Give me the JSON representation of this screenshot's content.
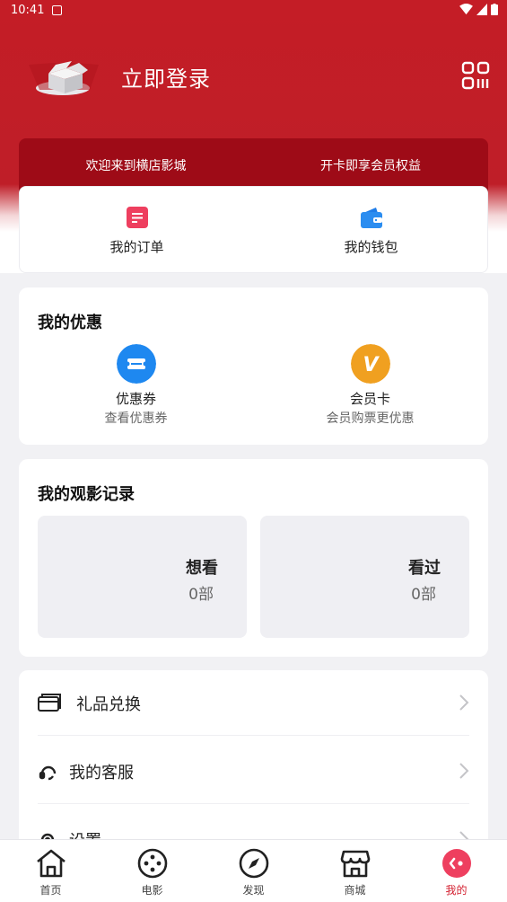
{
  "status_bar": {
    "time": "10:41"
  },
  "header": {
    "login_label": "立即登录"
  },
  "banner": {
    "left_text": "欢迎来到横店影城",
    "right_text": "开卡即享会员权益"
  },
  "quick_actions": [
    {
      "label": "我的订单",
      "icon": "order-icon"
    },
    {
      "label": "我的钱包",
      "icon": "wallet-icon"
    }
  ],
  "promotions": {
    "title": "我的优惠",
    "items": [
      {
        "title": "优惠券",
        "subtitle": "查看优惠券",
        "icon": "coupon-icon",
        "color": "#1e88f0"
      },
      {
        "title": "会员卡",
        "subtitle": "会员购票更优惠",
        "icon": "vip-card-icon",
        "color": "#f0a020"
      }
    ]
  },
  "watch_history": {
    "title": "我的观影记录",
    "items": [
      {
        "title": "想看",
        "count": "0部"
      },
      {
        "title": "看过",
        "count": "0部"
      }
    ]
  },
  "menu": [
    {
      "label": "礼品兑换",
      "icon": "gift-card-icon"
    },
    {
      "label": "我的客服",
      "icon": "headset-icon"
    },
    {
      "label": "设置",
      "icon": "settings-icon"
    }
  ],
  "tabs": [
    {
      "label": "首页",
      "icon": "home-icon"
    },
    {
      "label": "电影",
      "icon": "film-reel-icon"
    },
    {
      "label": "发现",
      "icon": "compass-icon"
    },
    {
      "label": "商城",
      "icon": "store-icon"
    },
    {
      "label": "我的",
      "icon": "profile-icon",
      "active": true
    }
  ],
  "colors": {
    "brand_red": "#c41d26",
    "banner_dark_red": "#9e0b17",
    "active_tab": "#d31f2f"
  }
}
